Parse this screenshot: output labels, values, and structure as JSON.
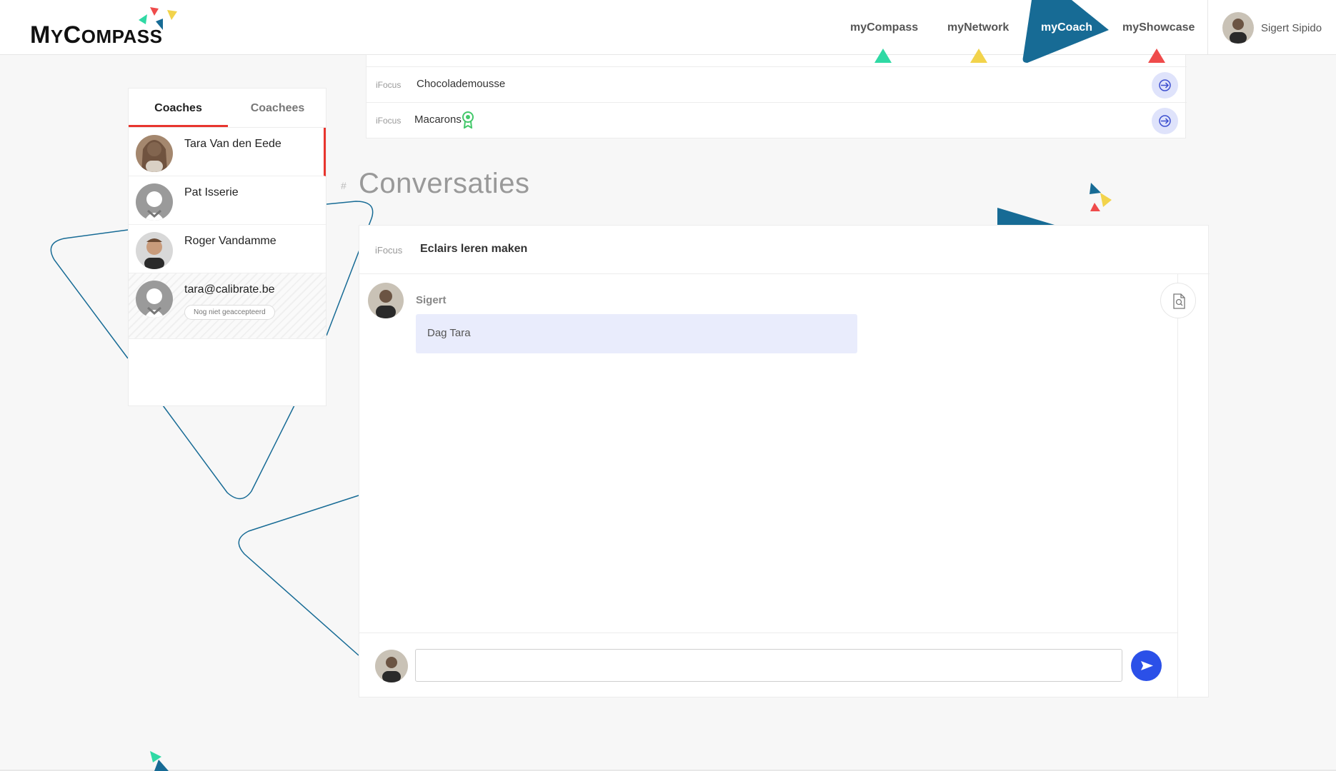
{
  "app": {
    "logo_prefix": "M",
    "logo_rest": "Y",
    "logo_c": "C",
    "logo_rest2": "OMPASS"
  },
  "nav": {
    "items": [
      {
        "label": "myCompass",
        "marker_color": "#2fd9a4"
      },
      {
        "label": "myNetwork",
        "marker_color": "#f2d34b"
      },
      {
        "label": "myCoach",
        "marker_color": "#176b95",
        "active": true
      },
      {
        "label": "myShowcase",
        "marker_color": "#ef4b4b"
      }
    ],
    "user_name": "Sigert Sipido"
  },
  "coach_panel": {
    "tabs": [
      "Coaches",
      "Coachees"
    ],
    "active_tab": "Coaches",
    "coaches": [
      {
        "name": "Tara Van den Eede",
        "active": true
      },
      {
        "name": "Pat Isserie"
      },
      {
        "name": "Roger Vandamme"
      },
      {
        "name": "tara@calibrate.be",
        "pending_label": "Nog niet geaccepteerd"
      }
    ]
  },
  "ifocus_list": {
    "rows": [
      {
        "tag": "iFocus",
        "title": "Chocolademousse"
      },
      {
        "tag": "iFocus",
        "title": "Macarons",
        "has_badge_icon": true
      }
    ]
  },
  "section": {
    "hash": "#",
    "title": "Conversaties"
  },
  "conversation": {
    "tag": "iFocus",
    "title": "Eclairs leren maken",
    "messages": [
      {
        "author": "Sigert",
        "text": "Dag Tara"
      }
    ],
    "input_value": "",
    "input_placeholder": ""
  },
  "colors": {
    "accent_red": "#e8352e",
    "brand_blue": "#176b95",
    "send_blue": "#2b50e8",
    "bubble_bg": "#e9ecfc"
  }
}
